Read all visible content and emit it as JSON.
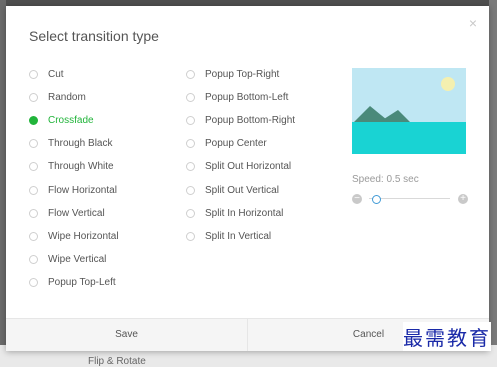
{
  "dialog": {
    "title": "Select transition type",
    "close_symbol": "×",
    "column1": [
      "Cut",
      "Random",
      "Crossfade",
      "Through Black",
      "Through White",
      "Flow Horizontal",
      "Flow Vertical",
      "Wipe Horizontal",
      "Wipe Vertical",
      "Popup Top-Left"
    ],
    "column2": [
      "Popup Top-Right",
      "Popup Bottom-Left",
      "Popup Bottom-Right",
      "Popup Center",
      "Split Out Horizontal",
      "Split Out Vertical",
      "Split In Horizontal",
      "Split In Vertical"
    ],
    "selected": "Crossfade",
    "speed_label": "Speed: 0.5 sec",
    "speed_value_fraction": 0.05,
    "save_label": "Save",
    "cancel_label": "Cancel"
  },
  "background": {
    "bottom_label": "Flip & Rotate"
  },
  "watermark": "最需教育",
  "colors": {
    "accent_green": "#21b43a",
    "sky": "#bfe7f3",
    "sea": "#19d3d3",
    "mountains": "#4a8a7a",
    "sun": "#f4f0b0"
  },
  "icons": {
    "close": "close-icon",
    "minus": "minus-icon",
    "plus": "plus-icon"
  }
}
